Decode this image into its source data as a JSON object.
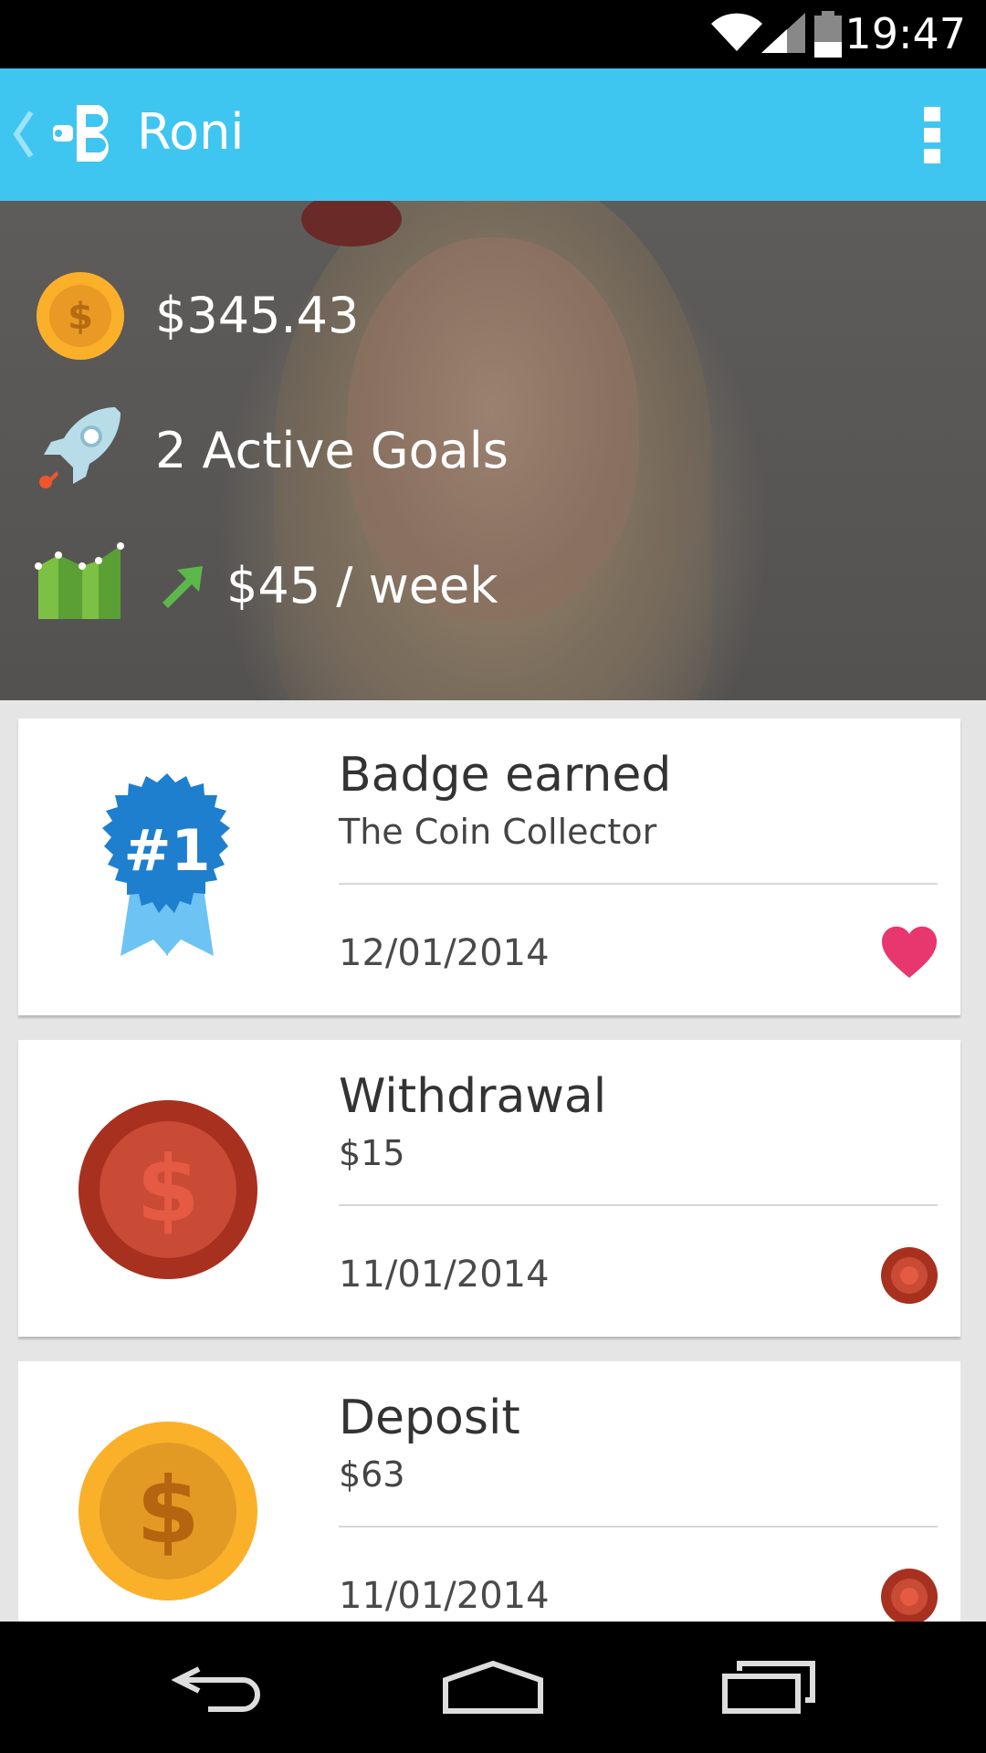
{
  "status_bar": {
    "time": "19:47"
  },
  "app_bar": {
    "title": "Roni"
  },
  "summary": {
    "balance": "$345.43",
    "goals": "2 Active Goals",
    "rate": "$45 / week"
  },
  "feed": [
    {
      "title": "Badge earned",
      "subtitle": "The Coin Collector",
      "date": "12/01/2014",
      "badge_text": "#1",
      "icon": "ribbon-badge-icon",
      "trail_icon": "heart-icon"
    },
    {
      "title": "Withdrawal",
      "subtitle": "$15",
      "date": "11/01/2014",
      "icon": "dollar-coin-icon",
      "trail_icon": "record-dot-icon"
    },
    {
      "title": "Deposit",
      "subtitle": "$63",
      "date": "11/01/2014",
      "icon": "dollar-coin-icon",
      "trail_icon": "record-dot-icon"
    }
  ],
  "colors": {
    "app_bar": "#3ec5f0",
    "withdrawal": "#a8301f",
    "deposit": "#fbb02a",
    "heart": "#e8366f",
    "badge": "#1e7fcf"
  }
}
